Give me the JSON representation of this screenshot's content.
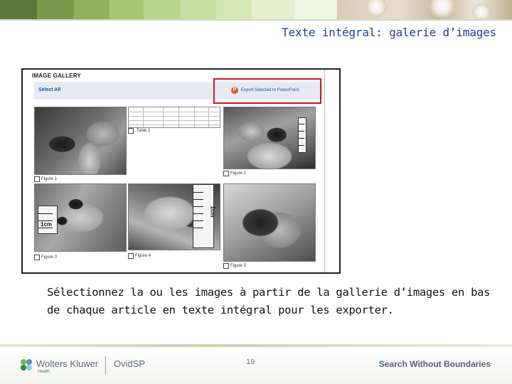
{
  "slide": {
    "title": "Texte intégral: galerie d’images",
    "body": "Sélectionnez la ou les images à partir de la gallerie d’images en bas de chaque article en texte intégral pour les exporter.",
    "page_number": "19"
  },
  "gallery": {
    "heading": "IMAGE GALLERY",
    "select_all": "Select All",
    "export_label": "Export Selected to PowerPoint",
    "items": [
      {
        "caption": "Figure 1"
      },
      {
        "caption": "Table 1"
      },
      {
        "caption": "Figure 2"
      },
      {
        "caption": "Figure 3"
      },
      {
        "caption": "Figure 4"
      },
      {
        "caption": "Figure 5"
      }
    ],
    "ruler_labels": [
      "1cm",
      "1cm"
    ]
  },
  "footer": {
    "brand": "Wolters Kluwer",
    "brand_sub": "Health",
    "product": "OvidSP",
    "tagline": "Search Without Boundaries"
  },
  "colors": {
    "title": "#1f3f9b",
    "highlight": "#d0191a",
    "tagline": "#4d6385",
    "brand_green": "#2f8a3b"
  }
}
